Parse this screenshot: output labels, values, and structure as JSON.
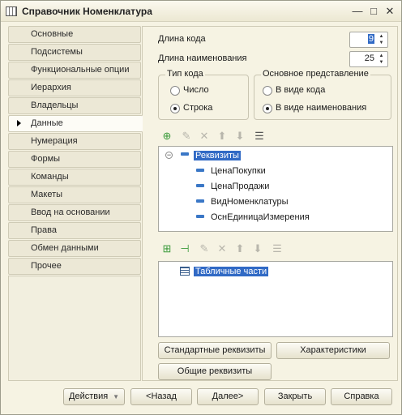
{
  "window": {
    "title": "Справочник Номенклатура",
    "controls": {
      "minimize": "—",
      "maximize": "□",
      "close": "✕"
    }
  },
  "sidebar": {
    "items": [
      {
        "label": "Основные",
        "active": false
      },
      {
        "label": "Подсистемы",
        "active": false
      },
      {
        "label": "Функциональные опции",
        "active": false
      },
      {
        "label": "Иерархия",
        "active": false
      },
      {
        "label": "Владельцы",
        "active": false
      },
      {
        "label": "Данные",
        "active": true
      },
      {
        "label": "Нумерация",
        "active": false
      },
      {
        "label": "Формы",
        "active": false
      },
      {
        "label": "Команды",
        "active": false
      },
      {
        "label": "Макеты",
        "active": false
      },
      {
        "label": "Ввод на основании",
        "active": false
      },
      {
        "label": "Права",
        "active": false
      },
      {
        "label": "Обмен данными",
        "active": false
      },
      {
        "label": "Прочее",
        "active": false
      }
    ]
  },
  "data_tab": {
    "code_length_label": "Длина кода",
    "code_length_value": "9",
    "name_length_label": "Длина наименования",
    "name_length_value": "25",
    "code_type": {
      "title": "Тип кода",
      "options": [
        {
          "label": "Число",
          "selected": false
        },
        {
          "label": "Строка",
          "selected": true
        }
      ]
    },
    "main_presentation": {
      "title": "Основное представление",
      "options": [
        {
          "label": "В виде кода",
          "selected": false
        },
        {
          "label": "В виде наименования",
          "selected": true
        }
      ]
    },
    "attributes_tree": {
      "root": "Реквизиты",
      "items": [
        "ЦенаПокупки",
        "ЦенаПродажи",
        "ВидНоменклатуры",
        "ОснЕдиницаИзмерения"
      ]
    },
    "tabular_tree": {
      "root": "Табличные части"
    },
    "buttons": {
      "standard_attrs": "Стандартные реквизиты",
      "characteristics": "Характеристики",
      "common_attrs": "Общие реквизиты"
    }
  },
  "footer": {
    "actions": "Действия",
    "back": "<Назад",
    "next": "Далее>",
    "close": "Закрыть",
    "help": "Справка"
  },
  "icons": {
    "add": "add-icon",
    "edit": "edit-icon",
    "delete": "delete-icon",
    "move_up": "move-up-icon",
    "move_down": "move-down-icon",
    "sort": "sort-icon"
  },
  "colors": {
    "selection": "#316ac5",
    "add_green": "#3a9a3a"
  }
}
